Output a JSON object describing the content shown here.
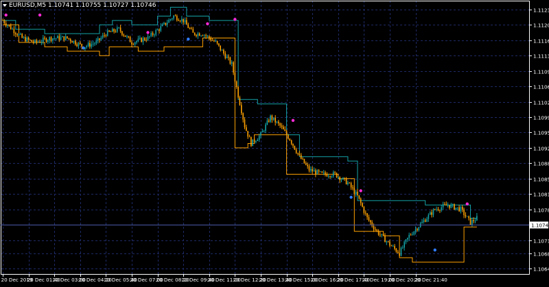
{
  "header": {
    "symbol_info": "EURUSD,M5  1.10741 1.10755 1.10727 1.10746"
  },
  "colors": {
    "background": "#000000",
    "frame": "#ffffff",
    "grid": "#1e2a66",
    "axis_text": "#ffffff",
    "candles": "#ffa200",
    "upper_band": "#14a3a8",
    "lower_band": "#ffa200",
    "current_price_line": "#4a5aa8",
    "price_marker_bg": "#ffffff",
    "price_marker_text": "#000000",
    "dot_magenta": "#ff2bd6",
    "dot_blue": "#2f7cff"
  },
  "chart_data": {
    "type": "candlestick",
    "symbol": "EURUSD",
    "timeframe": "M5",
    "last_price": "1.10746",
    "y_ticks": [
      "1.11235",
      "1.11200",
      "1.11165",
      "1.11130",
      "1.11095",
      "1.11060",
      "1.11025",
      "1.10990",
      "1.10955",
      "1.10920",
      "1.10885",
      "1.10850",
      "1.10815",
      "1.10780",
      "1.10710",
      "1.10680",
      "1.10645"
    ],
    "y_tick_values": [
      1.11235,
      1.112,
      1.11165,
      1.1113,
      1.11095,
      1.1106,
      1.11025,
      1.1099,
      1.10955,
      1.1092,
      1.10885,
      1.1085,
      1.10815,
      1.1078,
      1.1071,
      1.1068,
      1.10645
    ],
    "ylim": [
      1.10633,
      1.11255
    ],
    "x_labels": [
      "20 Dec 2019",
      "20 Dec 01:40",
      "20 Dec 03:00",
      "20 Dec 04:20",
      "20 Dec 05:40",
      "20 Dec 07:00",
      "20 Dec 08:20",
      "20 Dec 09:40",
      "20 Dec 11:00",
      "20 Dec 12:20",
      "20 Dec 13:40",
      "20 Dec 15:00",
      "20 Dec 16:20",
      "20 Dec 17:40",
      "20 Dec 19:00",
      "20 Dec 20:20",
      "20 Dec 21:40"
    ],
    "bars_total": 264,
    "bars_per_label": 16,
    "price_path": [
      [
        0,
        1.1121
      ],
      [
        6,
        1.1119
      ],
      [
        12,
        1.1117
      ],
      [
        20,
        1.1116
      ],
      [
        30,
        1.1117
      ],
      [
        40,
        1.1117
      ],
      [
        50,
        1.1115
      ],
      [
        58,
        1.1116
      ],
      [
        64,
        1.1118
      ],
      [
        72,
        1.1119
      ],
      [
        80,
        1.1116
      ],
      [
        90,
        1.1117
      ],
      [
        100,
        1.112
      ],
      [
        106,
        1.1122
      ],
      [
        112,
        1.1121
      ],
      [
        118,
        1.1118
      ],
      [
        124,
        1.1118
      ],
      [
        132,
        1.1116
      ],
      [
        138,
        1.1113
      ],
      [
        142,
        1.1111
      ],
      [
        146,
        1.1104
      ],
      [
        150,
        1.1097
      ],
      [
        154,
        1.1093
      ],
      [
        160,
        1.1095
      ],
      [
        166,
        1.1099
      ],
      [
        172,
        1.1097
      ],
      [
        178,
        1.1094
      ],
      [
        184,
        1.109
      ],
      [
        190,
        1.1087
      ],
      [
        198,
        1.1086
      ],
      [
        206,
        1.1086
      ],
      [
        214,
        1.1084
      ],
      [
        220,
        1.1081
      ],
      [
        226,
        1.1076
      ],
      [
        232,
        1.1073
      ],
      [
        240,
        1.107
      ],
      [
        246,
        1.1068
      ],
      [
        252,
        1.1072
      ],
      [
        260,
        1.1075
      ],
      [
        268,
        1.1078
      ],
      [
        276,
        1.1079
      ],
      [
        284,
        1.1078
      ],
      [
        290,
        1.1075
      ],
      [
        294,
        1.1076
      ]
    ],
    "upper_band": [
      [
        0,
        1.1121
      ],
      [
        8,
        1.1121
      ],
      [
        8,
        1.1119
      ],
      [
        26,
        1.1119
      ],
      [
        26,
        1.1118
      ],
      [
        60,
        1.1118
      ],
      [
        60,
        1.112
      ],
      [
        68,
        1.112
      ],
      [
        68,
        1.1121
      ],
      [
        80,
        1.1121
      ],
      [
        80,
        1.112
      ],
      [
        96,
        1.112
      ],
      [
        96,
        1.1122
      ],
      [
        104,
        1.1122
      ],
      [
        104,
        1.1124
      ],
      [
        114,
        1.1124
      ],
      [
        114,
        1.1122
      ],
      [
        128,
        1.1122
      ],
      [
        128,
        1.1121
      ],
      [
        146,
        1.1121
      ],
      [
        146,
        1.1103
      ],
      [
        158,
        1.1103
      ],
      [
        158,
        1.1102
      ],
      [
        176,
        1.1102
      ],
      [
        176,
        1.1095
      ],
      [
        184,
        1.1095
      ],
      [
        184,
        1.109
      ],
      [
        214,
        1.109
      ],
      [
        214,
        1.1089
      ],
      [
        220,
        1.1089
      ],
      [
        220,
        1.108
      ],
      [
        262,
        1.108
      ],
      [
        262,
        1.1079
      ],
      [
        290,
        1.1079
      ],
      [
        290,
        1.1076
      ],
      [
        294,
        1.1076
      ]
    ],
    "lower_band": [
      [
        0,
        1.112
      ],
      [
        10,
        1.112
      ],
      [
        10,
        1.1116
      ],
      [
        26,
        1.1116
      ],
      [
        26,
        1.1115
      ],
      [
        40,
        1.1115
      ],
      [
        40,
        1.1114
      ],
      [
        60,
        1.1114
      ],
      [
        60,
        1.1113
      ],
      [
        66,
        1.1113
      ],
      [
        66,
        1.1115
      ],
      [
        84,
        1.1115
      ],
      [
        84,
        1.1114
      ],
      [
        100,
        1.1114
      ],
      [
        100,
        1.1115
      ],
      [
        124,
        1.1115
      ],
      [
        124,
        1.1117
      ],
      [
        144,
        1.1117
      ],
      [
        144,
        1.1092
      ],
      [
        152,
        1.1092
      ],
      [
        152,
        1.1093
      ],
      [
        156,
        1.1093
      ],
      [
        156,
        1.1095
      ],
      [
        176,
        1.1095
      ],
      [
        176,
        1.1086
      ],
      [
        208,
        1.1086
      ],
      [
        208,
        1.1085
      ],
      [
        218,
        1.1085
      ],
      [
        218,
        1.1073
      ],
      [
        236,
        1.1073
      ],
      [
        236,
        1.1072
      ],
      [
        246,
        1.1072
      ],
      [
        246,
        1.1067
      ],
      [
        254,
        1.1067
      ],
      [
        254,
        1.1066
      ],
      [
        286,
        1.1066
      ],
      [
        286,
        1.1074
      ],
      [
        294,
        1.1074
      ]
    ],
    "markers": [
      {
        "bar": 2,
        "price": 1.1121,
        "color": "magenta"
      },
      {
        "bar": 23,
        "price": 1.1121,
        "color": "magenta"
      },
      {
        "bar": 50,
        "price": 1.1116,
        "color": "blue"
      },
      {
        "bar": 90,
        "price": 1.1117,
        "color": "magenta"
      },
      {
        "bar": 115,
        "price": 1.1118,
        "color": "blue"
      },
      {
        "bar": 127,
        "price": 1.1119,
        "color": "magenta"
      },
      {
        "bar": 144,
        "price": 1.112,
        "color": "magenta"
      },
      {
        "bar": 180,
        "price": 1.1097,
        "color": "magenta"
      },
      {
        "bar": 216,
        "price": 1.1082,
        "color": "blue"
      },
      {
        "bar": 222,
        "price": 1.1081,
        "color": "magenta"
      },
      {
        "bar": 268,
        "price": 1.107,
        "color": "blue"
      },
      {
        "bar": 288,
        "price": 1.1078,
        "color": "magenta"
      }
    ]
  }
}
